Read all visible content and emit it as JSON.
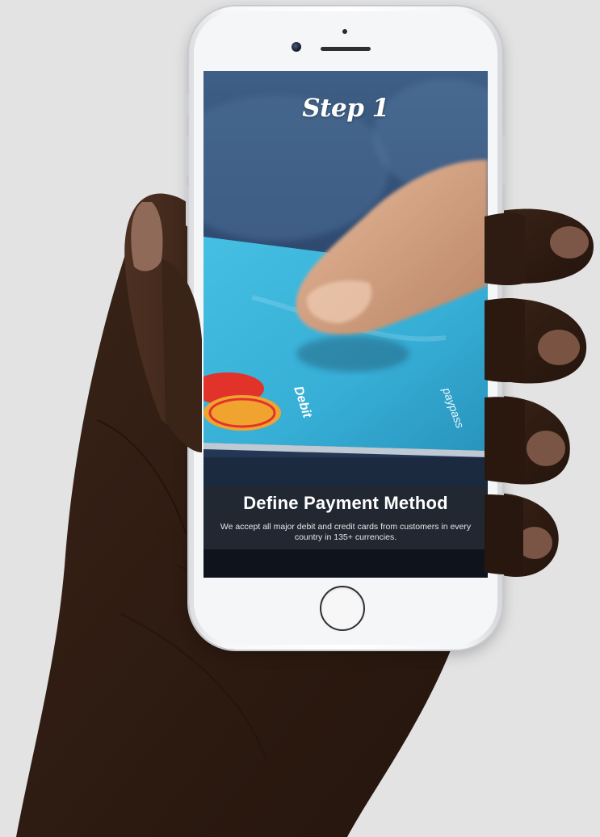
{
  "screen": {
    "step_title": "Step 1",
    "caption_heading": "Define Payment Method",
    "caption_text": "We accept all major debit and credit cards from customers in every country in 135+ currencies.",
    "card_label": "Debit",
    "card_brand_text": "paypass"
  },
  "colors": {
    "background": "#e3e3e4",
    "screen_blue": "#2a3e5b",
    "card_cyan": "#3db6dc",
    "mastercard_red": "#e2332b",
    "mastercard_orange": "#f0a42f"
  },
  "icons": {
    "home_button": "home-button-circle",
    "camera": "front-camera-icon",
    "speaker": "earpiece-speaker-icon"
  }
}
